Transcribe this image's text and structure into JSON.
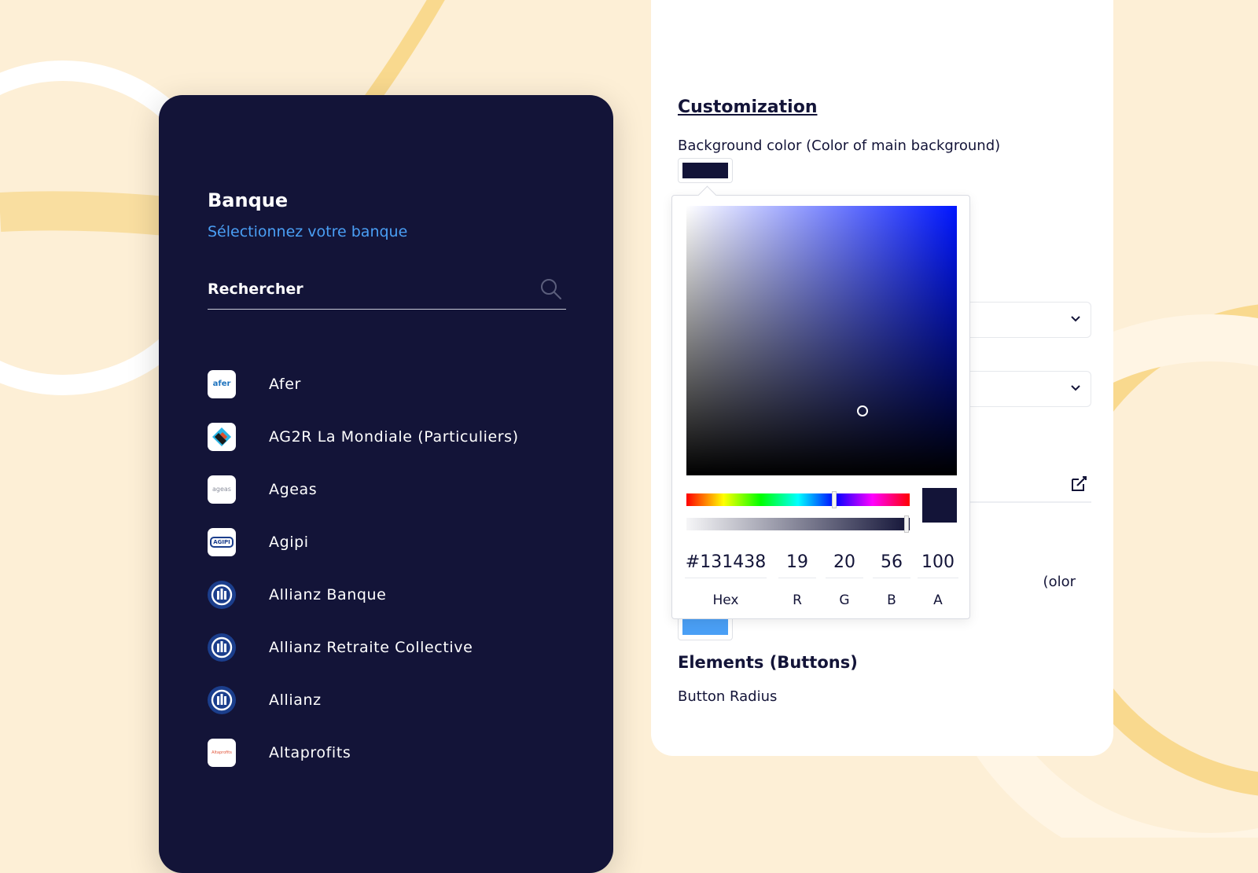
{
  "bank_panel": {
    "title": "Banque",
    "subtitle": "Sélectionnez votre banque",
    "search_placeholder": "Rechercher",
    "banks": [
      {
        "name": "Afer",
        "logo_text": "afer"
      },
      {
        "name": "AG2R La Mondiale (Particuliers)"
      },
      {
        "name": "Ageas",
        "logo_text": "ageas"
      },
      {
        "name": "Agipi",
        "logo_text": "AGIPI"
      },
      {
        "name": "Allianz Banque"
      },
      {
        "name": "Allianz Retraite Collective"
      },
      {
        "name": "Allianz"
      },
      {
        "name": "Altaprofits",
        "logo_text": "Altaprofits"
      }
    ]
  },
  "customization": {
    "title": "Customization",
    "background_color_label": "Background color (Color of main background)",
    "background_color": "#131438",
    "partial_label": "olor)",
    "secondary_color": "#4a9ff5",
    "elements_title": "Elements (Buttons)",
    "button_radius_label": "Button Radius"
  },
  "color_picker": {
    "hex": "#131438",
    "r": "19",
    "g": "20",
    "b": "56",
    "a": "100",
    "labels": {
      "hex": "Hex",
      "r": "R",
      "g": "G",
      "b": "B",
      "a": "A"
    }
  },
  "colors": {
    "page_background": "#fdefd6",
    "panel_background": "#131438",
    "accent_blue": "#4a9ff5",
    "decor_yellow": "#f9d98e"
  }
}
